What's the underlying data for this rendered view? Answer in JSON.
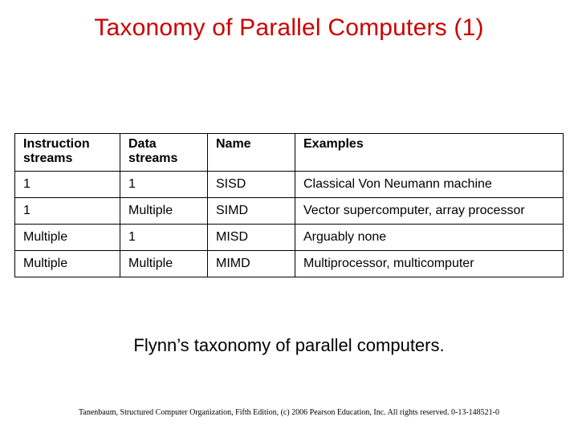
{
  "title": "Taxonomy of Parallel Computers (1)",
  "table": {
    "headers": {
      "instruction": "Instruction\nstreams",
      "data": "Data\nstreams",
      "name": "Name",
      "examples": "Examples"
    },
    "rows": [
      {
        "instruction": "1",
        "data": "1",
        "name": "SISD",
        "examples": "Classical Von Neumann machine"
      },
      {
        "instruction": "1",
        "data": "Multiple",
        "name": "SIMD",
        "examples": "Vector supercomputer, array processor"
      },
      {
        "instruction": "Multiple",
        "data": "1",
        "name": "MISD",
        "examples": "Arguably none"
      },
      {
        "instruction": "Multiple",
        "data": "Multiple",
        "name": "MIMD",
        "examples": "Multiprocessor, multicomputer"
      }
    ]
  },
  "caption": "Flynn’s taxonomy of parallel computers.",
  "footer": "Tanenbaum, Structured Computer Organization, Fifth Edition, (c) 2006 Pearson Education, Inc. All rights reserved. 0-13-148521-0",
  "chart_data": {
    "type": "table",
    "title": "Flynn's taxonomy of parallel computers",
    "columns": [
      "Instruction streams",
      "Data streams",
      "Name",
      "Examples"
    ],
    "rows": [
      [
        "1",
        "1",
        "SISD",
        "Classical Von Neumann machine"
      ],
      [
        "1",
        "Multiple",
        "SIMD",
        "Vector supercomputer, array processor"
      ],
      [
        "Multiple",
        "1",
        "MISD",
        "Arguably none"
      ],
      [
        "Multiple",
        "Multiple",
        "MIMD",
        "Multiprocessor, multicomputer"
      ]
    ]
  }
}
